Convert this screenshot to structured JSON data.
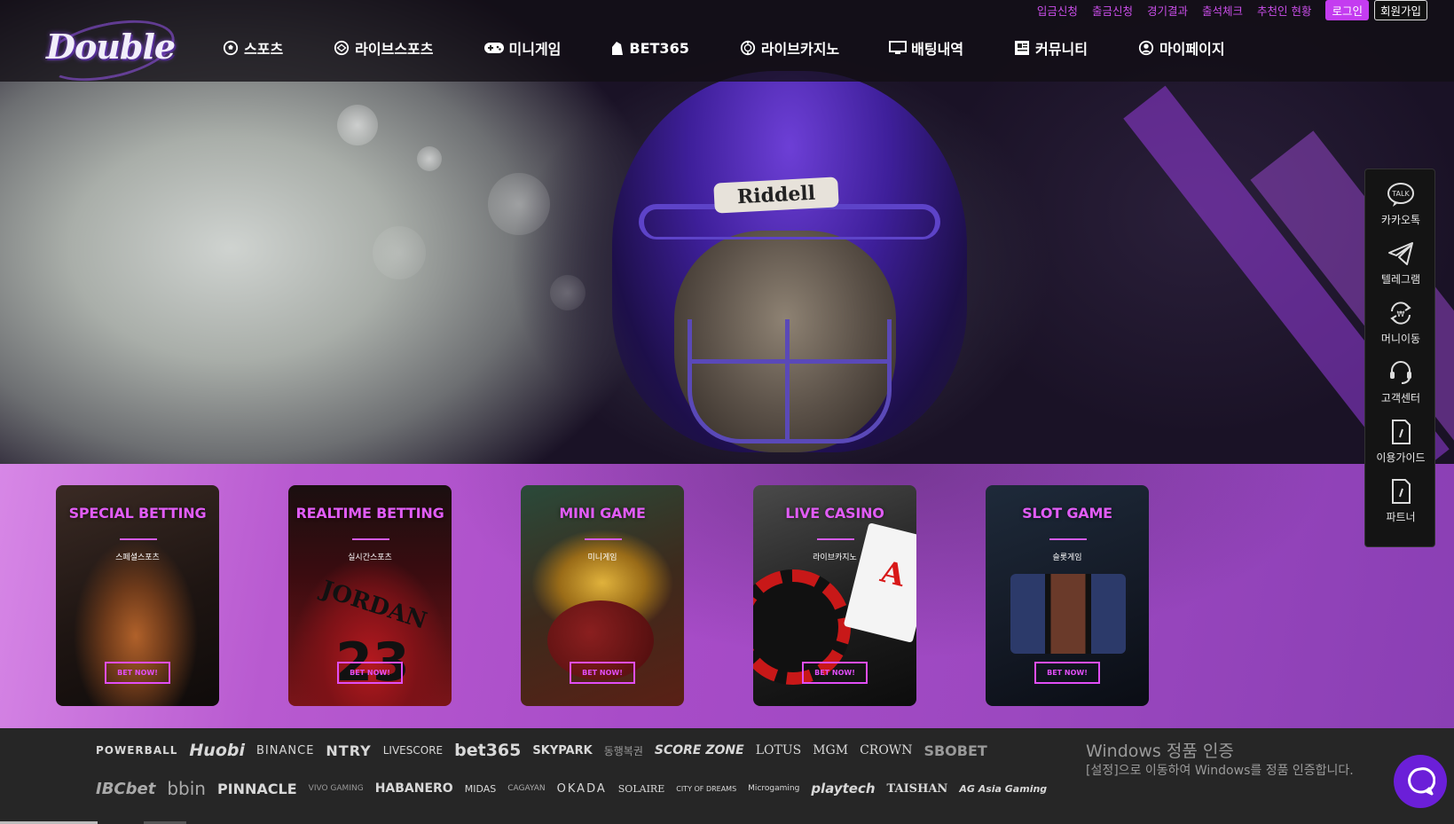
{
  "header": {
    "logo_text": "Double",
    "top_links": [
      "입금신청",
      "출금신청",
      "경기결과",
      "출석체크",
      "추천인 현황"
    ],
    "login_label": "로그인",
    "join_label": "회원가입",
    "nav": [
      {
        "label": "스포츠",
        "icon": "soccer-ball-icon"
      },
      {
        "label": "라이브스포츠",
        "icon": "live-sports-icon"
      },
      {
        "label": "미니게임",
        "icon": "gamepad-icon"
      },
      {
        "label": "BET365",
        "icon": "bet365-icon"
      },
      {
        "label": "라이브카지노",
        "icon": "casino-chip-icon"
      },
      {
        "label": "배팅내역",
        "icon": "monitor-icon"
      },
      {
        "label": "커뮤니티",
        "icon": "newspaper-icon"
      },
      {
        "label": "마이페이지",
        "icon": "user-circle-icon"
      }
    ]
  },
  "hero": {
    "helmet_brand": "Riddell"
  },
  "side_panel": [
    {
      "label": "카카오톡",
      "icon": "kakaotalk-icon"
    },
    {
      "label": "텔레그램",
      "icon": "telegram-icon"
    },
    {
      "label": "머니이동",
      "icon": "money-transfer-icon"
    },
    {
      "label": "고객센터",
      "icon": "headset-icon"
    },
    {
      "label": "이용가이드",
      "icon": "guide-document-icon"
    },
    {
      "label": "파트너",
      "icon": "partner-document-icon"
    }
  ],
  "cards": [
    {
      "title": "SPECIAL BETTING",
      "subtitle": "스페셜스포츠",
      "button": "BET NOW!"
    },
    {
      "title": "REALTIME BETTING",
      "subtitle": "실시간스포츠",
      "button": "BET NOW!"
    },
    {
      "title": "MINI GAME",
      "subtitle": "미니게임",
      "button": "BET NOW!"
    },
    {
      "title": "LIVE CASINO",
      "subtitle": "라이브카지노",
      "button": "BET NOW!"
    },
    {
      "title": "SLOT GAME",
      "subtitle": "슬롯게임",
      "button": "BET NOW!"
    }
  ],
  "partners_row1": [
    "POWERBALL",
    "Huobi",
    "BINANCE",
    "NTRY",
    "LIVESCORE",
    "bet365",
    "SKYPARK",
    "동행복권",
    "SCORE ZONE",
    "LOTUS",
    "MGM",
    "CROWN",
    "SBOBET"
  ],
  "partners_row2": [
    "IBCbet",
    "bbin",
    "PINNACLE",
    "VIVO GAMING",
    "HABANERO",
    "MIDAS",
    "CAGAYAN",
    "OKADA",
    "SOLAIRE",
    "CITY OF DREAMS",
    "Microgaming",
    "playtech",
    "TAISHAN",
    "AG Asia Gaming"
  ],
  "windows_notice": {
    "title": "Windows 정품 인증",
    "subtitle": "[설정]으로 이동하여 Windows를 정품 인증합니다."
  },
  "colors": {
    "accent": "#c94ee8",
    "card_title": "#e15cf6",
    "cards_band": "#a84cc8",
    "footer": "#262626",
    "chat": "#6b1fd8"
  }
}
